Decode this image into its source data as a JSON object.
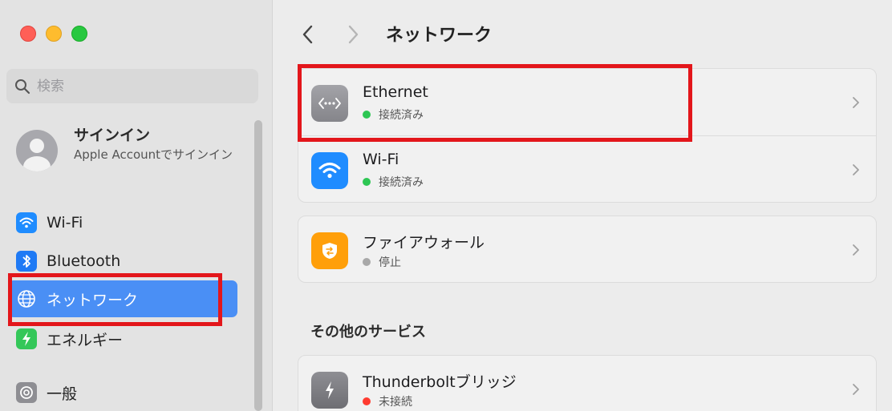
{
  "window": {
    "title": "ネットワーク"
  },
  "search": {
    "placeholder": "検索"
  },
  "account": {
    "title": "サインイン",
    "subtitle": "Apple Accountでサインイン"
  },
  "sidebar": {
    "items": [
      {
        "label": "Wi-Fi",
        "icon": "wifi-icon",
        "color": "#1f8cff"
      },
      {
        "label": "Bluetooth",
        "icon": "bluetooth-icon",
        "color": "#1f7af5"
      },
      {
        "label": "ネットワーク",
        "icon": "globe-icon",
        "color": "#3e7de8",
        "selected": true
      },
      {
        "label": "エネルギー",
        "icon": "bolt-icon",
        "color": "#34c759"
      },
      {
        "label": "一般",
        "icon": "gear-icon",
        "color": "#8e8e93"
      }
    ]
  },
  "services": [
    {
      "name": "Ethernet",
      "status": "接続済み",
      "status_color": "#2dc653",
      "icon": "ethernet-icon"
    },
    {
      "name": "Wi-Fi",
      "status": "接続済み",
      "status_color": "#2dc653",
      "icon": "wifi-icon"
    }
  ],
  "firewall": {
    "name": "ファイアウォール",
    "status": "停止",
    "status_color": "#a8a8a8",
    "icon": "firewall-icon"
  },
  "other_services": {
    "heading": "その他のサービス",
    "items": [
      {
        "name": "Thunderboltブリッジ",
        "status": "未接続",
        "status_color": "#ff3b30",
        "icon": "thunderbolt-icon"
      }
    ]
  },
  "colors": {
    "accent": "#4a8ff5",
    "annotation": "#e3161b"
  }
}
